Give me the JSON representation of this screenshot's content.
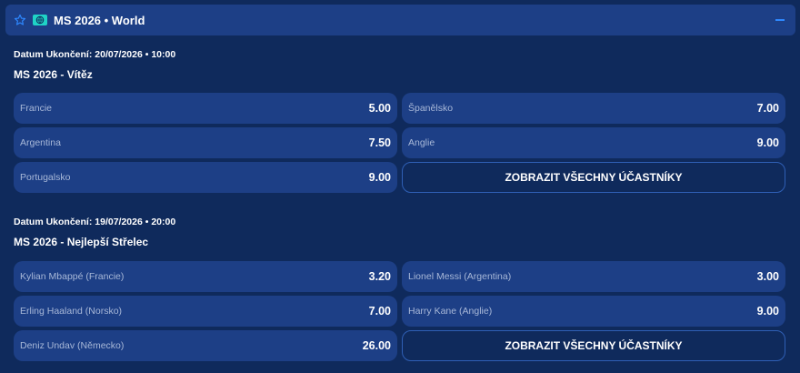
{
  "header": {
    "title": "MS 2026 • World",
    "icons": [
      "star-icon",
      "globe-icon",
      "collapse-icon"
    ],
    "accent": "#2e88ff",
    "badge_color": "#1fd3c6"
  },
  "markets": [
    {
      "end_date": "Datum Ukončení: 20/07/2026 • 10:00",
      "title": "MS 2026 - Vítěz",
      "outcomes": [
        {
          "name": "Francie",
          "odds": "5.00"
        },
        {
          "name": "Španělsko",
          "odds": "7.00"
        },
        {
          "name": "Argentina",
          "odds": "7.50"
        },
        {
          "name": "Anglie",
          "odds": "9.00"
        },
        {
          "name": "Portugalsko",
          "odds": "9.00"
        }
      ],
      "show_all_label": "ZOBRAZIT VŠECHNY ÚČASTNÍKY"
    },
    {
      "end_date": "Datum Ukončení: 19/07/2026 • 20:00",
      "title": "MS 2026 - Nejlepší Střelec",
      "outcomes": [
        {
          "name": "Kylian Mbappé (Francie)",
          "odds": "3.20"
        },
        {
          "name": "Lionel Messi (Argentina)",
          "odds": "3.00"
        },
        {
          "name": "Erling Haaland (Norsko)",
          "odds": "7.00"
        },
        {
          "name": "Harry Kane (Anglie)",
          "odds": "9.00"
        },
        {
          "name": "Deniz Undav (Německo)",
          "odds": "26.00"
        }
      ],
      "show_all_label": "ZOBRAZIT VŠECHNY ÚČASTNÍKY"
    }
  ]
}
